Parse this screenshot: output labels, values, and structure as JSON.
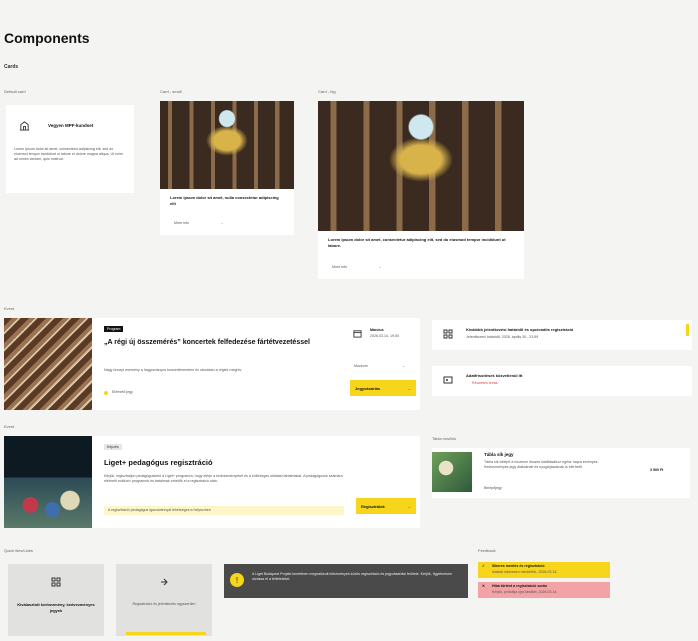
{
  "page": {
    "title": "Components",
    "section_cards": "Cards",
    "section_event": "Event",
    "section_rows": "Rows",
    "section_row_link": "Tabla row/link",
    "section_quick": "Quick tiles/Links",
    "section_feedback": "Feedback"
  },
  "cards": {
    "default_label": "Default card",
    "thumb_label": "Card - small",
    "big_label": "Card - big",
    "default_title": "Vegyen MPF-kundset",
    "default_body": "Lorem ipsum dolor sit amet, consectetur adipiscing elit, sed do eiusmod tempor incididunt ut labore et dolore magna aliqua. Ut enim ad minim veniam, quis nostrud.",
    "small_title": "Lorem ipsum dolor sit amet, nulla consectetur adipiscing elit",
    "small_btn": "More info",
    "big_title": "Lorem ipsum dolor sit amet, consectetur adipiscing elit, sed do eiusmod tempor incididunt ut labore.",
    "big_btn": "More info"
  },
  "event1": {
    "tag": "Program",
    "title": "„A régi új összemérés” koncertek felfedezése fártétvezetéssel",
    "desc": "Nagy ünnepi esemény a hagyományos koncertteremben és városban a régiek meghív.",
    "status": "Elérhető jegy",
    "date_label": "Március",
    "date_value": "2026.03.14, 19:00",
    "venue": "Múzeum",
    "cta": "Jegyvásárlás"
  },
  "event2": {
    "tag": "Képzés",
    "title": "Liget+ pedagógus regisztráció",
    "desc": "Kérjük, regisztráljon pedagógusként a Liget+ programra, hogy elérje a kedvezményeket és a különleges oktatási tartalmakat. A pedagógusok számára elérhető exkluzív programok és tartalmak érhetők el a regisztráció után.",
    "note": "A regisztráció pedagógus igazolvánnyal lehetséges a helyszínen",
    "cta": "Regisztrálok"
  },
  "rows": {
    "row1_title": "Kiválóbb jelentkezési határidő és opcionális regisztráció",
    "row1_sub": "Jelentkezési határidő: 2026. április 30., 23:59",
    "row2_title": "Adatfrissítések közvetlenül itt",
    "row2_sub": "Részletes leírás"
  },
  "row_link": {
    "title": "Tábla sík jegy",
    "desc": "Tábla sík belépő a múzeum összes kiállításához egész napra érvényes. Kedvezményes jegy diákoknak és nyugdíjasoknak is elérhető.",
    "meta": "Belépőjegy",
    "price": "3 500 Ft"
  },
  "tiles": {
    "tile1": "Kiválasztott kedvezmény, kedvezményes jegyek",
    "tile2": "Regisztráció és jelentkezés egyszerűen"
  },
  "banner": {
    "text": "A Liget Budapest Projekt keretében megvalósult intézmények közös regisztráció és jegyvásárlási felülete. Kérjük, figyelmesen olvassa el a feltételeket."
  },
  "feedback": {
    "success_title": "Sikeres mentés és regisztráció",
    "success_sub": "Adatait sikeresen mentettük, 2026.03.14.",
    "error_title": "Hiba történt a regisztráció során",
    "error_sub": "Kérjük, próbálja újra később, 2026.03.14."
  },
  "colors": {
    "accent": "#f6d51a",
    "success": "#f6d51a",
    "error": "#f3a3a6",
    "dark_banner": "#4a4a4a"
  }
}
